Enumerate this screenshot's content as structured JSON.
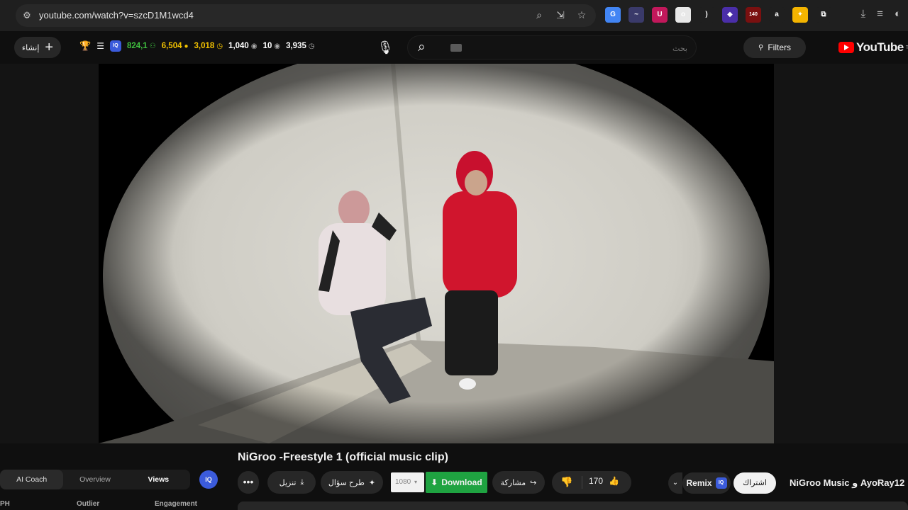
{
  "browser": {
    "url": "youtube.com/watch?v=szcD1M1wcd4",
    "extensions": [
      {
        "name": "translate-icon",
        "color": "#4285f4",
        "glyph": "G"
      },
      {
        "name": "wave-icon",
        "color": "#3a3a6a",
        "glyph": "~"
      },
      {
        "name": "u-icon",
        "color": "#c2185b",
        "glyph": "U"
      },
      {
        "name": "avatar-ext-icon",
        "color": "#e8e8e8",
        "glyph": "o"
      },
      {
        "name": "orange-ext-icon",
        "color": "#1f1f1f",
        "glyph": ")"
      },
      {
        "name": "gem-icon",
        "color": "#4a2ea8",
        "glyph": "◆"
      },
      {
        "name": "counter-ext-icon",
        "color": "#7a1010",
        "glyph": "140"
      },
      {
        "name": "amazon-icon",
        "color": "#1f1f1f",
        "glyph": "a"
      },
      {
        "name": "star-ext-icon",
        "color": "#f4b400",
        "glyph": "✦"
      },
      {
        "name": "puzzle-icon",
        "color": "#1f1f1f",
        "glyph": "⧉"
      }
    ]
  },
  "header": {
    "create_label": "إنشاء",
    "stats": [
      {
        "value": "824,1",
        "color": "#3fbf3f",
        "icon": "person-icon"
      },
      {
        "value": "6,504",
        "color": "#f2c200",
        "icon": "coin-icon"
      },
      {
        "value": "3,018",
        "color": "#f2c200",
        "icon": "clock-icon"
      },
      {
        "value": "1,040",
        "color": "#ffffff",
        "icon": "eye-icon"
      },
      {
        "value": "10",
        "color": "#ffffff",
        "icon": "eye-icon"
      },
      {
        "value": "3,935",
        "color": "#ffffff",
        "icon": "clock-icon"
      }
    ],
    "search_placeholder": "بحث",
    "filters_label": "Filters",
    "logo_text": "YouTube",
    "logo_tm": "TM"
  },
  "video": {
    "title": "NiGroo -Freestyle 1 (official music clip)",
    "channel": "NiGroo Music و AyoRay12",
    "subscribe_label": "اشتراك",
    "remix_label": "Remix",
    "likes": "170",
    "share_label": "مشاركة",
    "download_label": "Download",
    "quality": "1080",
    "ask_label": "طرح سؤال",
    "save_download_label": "تنزيل",
    "more_label": "•••"
  },
  "panel": {
    "tabs": [
      "AI Coach",
      "Overview",
      "Views"
    ],
    "sub_labels": [
      "PH",
      "Outlier",
      "Engagement"
    ],
    "iq_label": "IQ"
  }
}
